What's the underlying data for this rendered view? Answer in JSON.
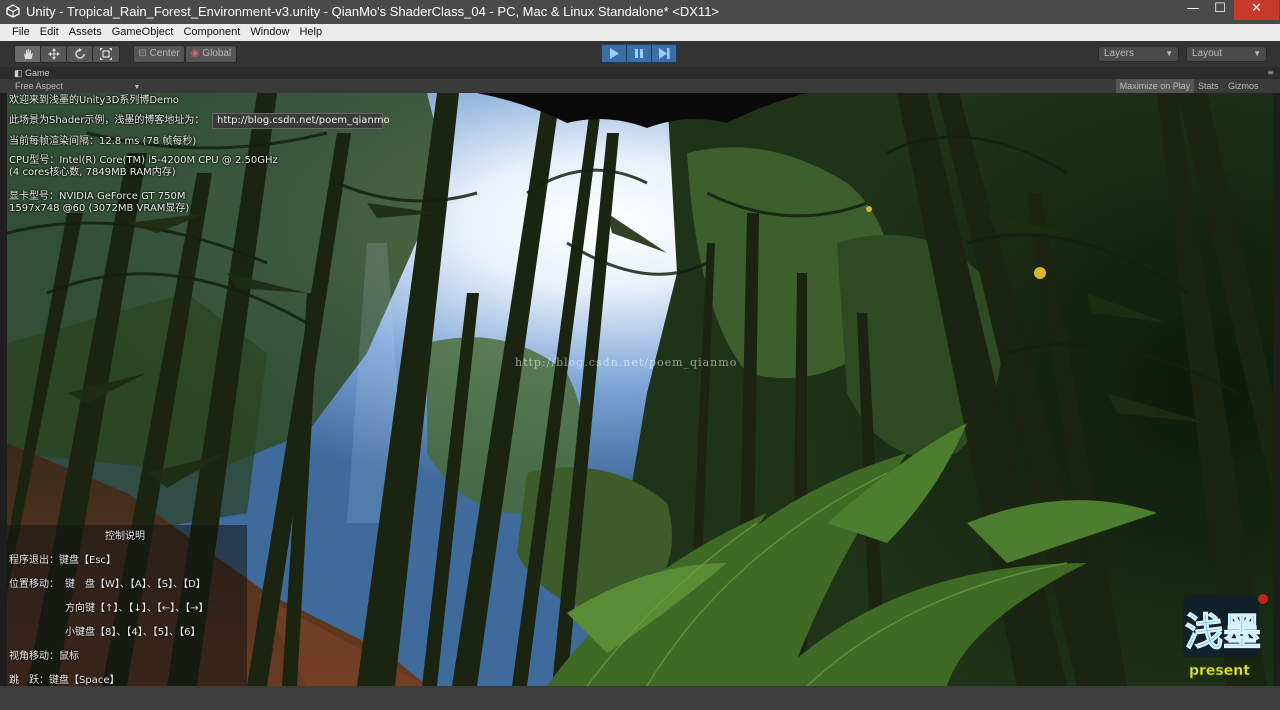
{
  "window": {
    "title": "Unity - Tropical_Rain_Forest_Environment-v3.unity - QianMo's ShaderClass_04 - PC, Mac & Linux Standalone* <DX11>",
    "minimize": "—",
    "maximize": "☐",
    "close": "✕"
  },
  "menu": [
    "File",
    "Edit",
    "Assets",
    "GameObject",
    "Component",
    "Window",
    "Help"
  ],
  "toolbar": {
    "pivot": "Center",
    "space": "Global",
    "layers": "Layers",
    "layout": "Layout"
  },
  "game_tab": {
    "label": "Game",
    "aspect": "Free Aspect",
    "maximize_on_play": "Maximize on Play",
    "stats": "Stats",
    "gizmos": "Gizmos"
  },
  "overlay": {
    "welcome": "欢迎来到浅墨的Unity3D系列博Demo",
    "scene_line": "此场景为Shader示例，浅墨的博客地址为：",
    "url": "http://blog.csdn.net/poem_qianmo",
    "frame_interval": "当前每帧渲染间隔：12.8 ms (78 帧每秒)",
    "cpu_model": "CPU型号：Intel(R) Core(TM) i5-4200M CPU @ 2.50GHz",
    "cpu_cores": "(4 cores核心数, 7849MB RAM内存)",
    "gpu_model": "显卡型号：NVIDIA GeForce GT 750M",
    "gpu_res": "1597x748 @60 (3072MB VRAM显存)"
  },
  "controls": {
    "title": "控制说明",
    "exit": "程序退出：键盘【Esc】",
    "move_label": "位置移动：",
    "move_wasd": "键　盘【W】、【A】、【S】、【D】",
    "move_arrows": "方向键【↑】、【↓】、【←】、【→】",
    "move_numpad": "小键盘【8】、【4】、【5】、【6】",
    "view": "视角移动：鼠标",
    "jump": "跳　跃：键盘【Space】"
  },
  "watermark": "http://blog.csdn.net/poem_qianmo",
  "logo": {
    "text": "浅墨",
    "sub": "present"
  },
  "colors": {
    "play_accent": "#3a6ea5",
    "close_button": "#c7392b"
  }
}
